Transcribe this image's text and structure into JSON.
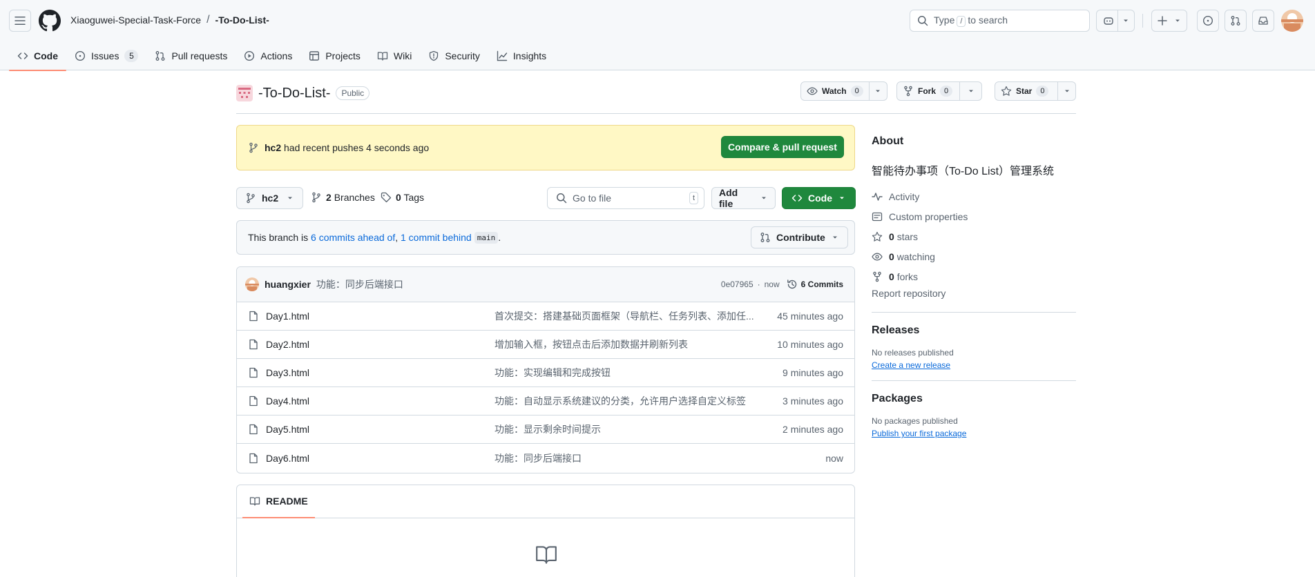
{
  "header": {
    "owner": "Xiaoguwei-Special-Task-Force",
    "separator": "/",
    "repo": "-To-Do-List-",
    "search_pre": "Type",
    "search_key": "/",
    "search_post": "to search"
  },
  "nav": {
    "tabs": [
      {
        "label": "Code",
        "icon": "code-icon",
        "selected": true
      },
      {
        "label": "Issues",
        "icon": "issue-icon",
        "count": "5"
      },
      {
        "label": "Pull requests",
        "icon": "pull-request-icon"
      },
      {
        "label": "Actions",
        "icon": "play-icon"
      },
      {
        "label": "Projects",
        "icon": "table-icon"
      },
      {
        "label": "Wiki",
        "icon": "book-icon"
      },
      {
        "label": "Security",
        "icon": "shield-icon"
      },
      {
        "label": "Insights",
        "icon": "graph-icon"
      }
    ]
  },
  "repo": {
    "name": "-To-Do-List-",
    "visibility": "Public",
    "watch_label": "Watch",
    "watch_count": "0",
    "fork_label": "Fork",
    "fork_count": "0",
    "star_label": "Star",
    "star_count": "0"
  },
  "push_banner": {
    "branch": "hc2",
    "text": "had recent pushes 4 seconds ago",
    "button": "Compare & pull request"
  },
  "branch_bar": {
    "current_branch": "hc2",
    "branches_count": "2",
    "branches_label": "Branches",
    "tags_count": "0",
    "tags_label": "Tags",
    "goto_placeholder": "Go to file",
    "goto_key": "t",
    "add_file": "Add file",
    "code_button": "Code"
  },
  "branch_info": {
    "prefix": "This branch is",
    "ahead": "6 commits ahead of",
    "comma": ",",
    "behind": "1 commit behind",
    "base": "main",
    "suffix": ".",
    "contribute": "Contribute"
  },
  "latest_commit": {
    "author": "huangxier",
    "message": "功能：同步后端接口",
    "sha": "0e07965",
    "dot": "·",
    "time": "now",
    "commits_label": "6 Commits"
  },
  "files": [
    {
      "name": "Day1.html",
      "message": "首次提交：搭建基础页面框架（导航栏、任务列表、添加任...",
      "time": "45 minutes ago"
    },
    {
      "name": "Day2.html",
      "message": "增加输入框，按钮点击后添加数据并刷新列表",
      "time": "10 minutes ago"
    },
    {
      "name": "Day3.html",
      "message": "功能：实现编辑和完成按钮",
      "time": "9 minutes ago"
    },
    {
      "name": "Day4.html",
      "message": "功能：自动显示系统建议的分类，允许用户选择自定义标签",
      "time": "3 minutes ago"
    },
    {
      "name": "Day5.html",
      "message": "功能：显示剩余时间提示",
      "time": "2 minutes ago"
    },
    {
      "name": "Day6.html",
      "message": "功能：同步后端接口",
      "time": "now"
    }
  ],
  "readme": {
    "tab": "README"
  },
  "sidebar": {
    "about_title": "About",
    "description": "智能待办事项（To-Do List）管理系统",
    "items": [
      {
        "icon": "pulse-icon",
        "count": "",
        "label": "Activity"
      },
      {
        "icon": "note-icon",
        "count": "",
        "label": "Custom properties"
      },
      {
        "icon": "star-icon",
        "count": "0",
        "label": "stars"
      },
      {
        "icon": "eye-icon",
        "count": "0",
        "label": "watching"
      },
      {
        "icon": "fork-icon",
        "count": "0",
        "label": "forks"
      }
    ],
    "report": "Report repository",
    "releases_title": "Releases",
    "releases_empty": "No releases published",
    "releases_link": "Create a new release",
    "packages_title": "Packages",
    "packages_empty": "No packages published",
    "packages_link": "Publish your first package"
  },
  "colors": {
    "accent": "#0969da",
    "primary_button": "#1f883d",
    "banner_bg": "#fff8c5",
    "tab_underline": "#fd8c73"
  }
}
